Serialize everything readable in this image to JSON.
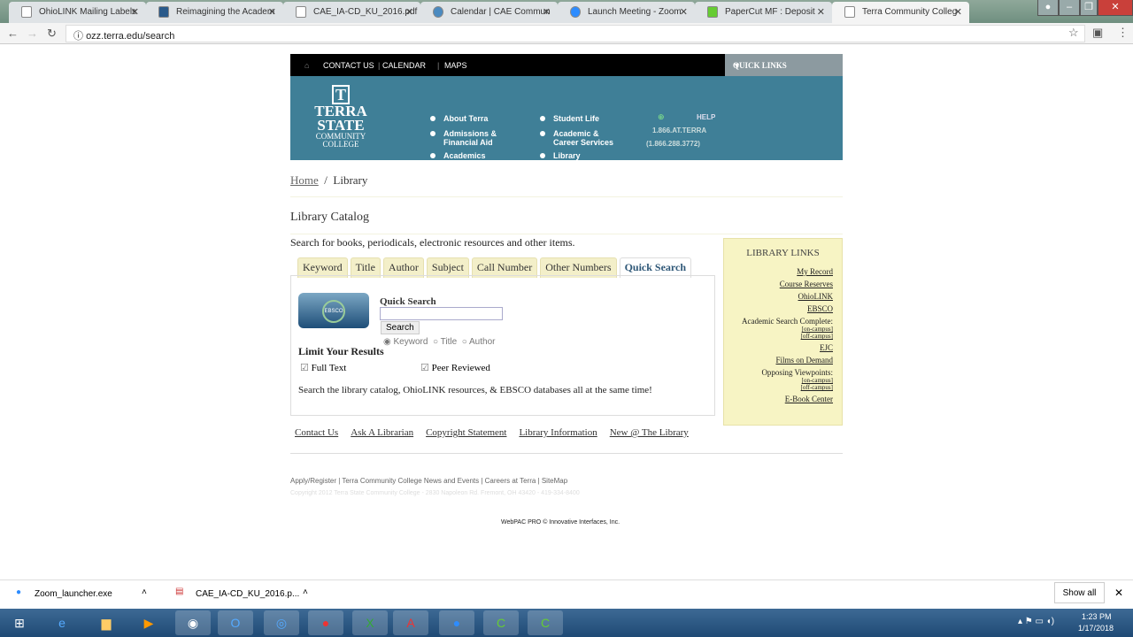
{
  "browser": {
    "tabs": [
      {
        "title": "OhioLINK Mailing Labels"
      },
      {
        "title": "Reimagining the Academ"
      },
      {
        "title": "CAE_IA-CD_KU_2016.pdf"
      },
      {
        "title": "Calendar | CAE Commun"
      },
      {
        "title": "Launch Meeting - Zoom"
      },
      {
        "title": "PaperCut MF : Deposit"
      },
      {
        "title": "Terra Community Colleg",
        "active": true
      }
    ],
    "url": "ozz.terra.edu/search"
  },
  "site": {
    "topnav": [
      "CONTACT US",
      "CALENDAR",
      "MAPS"
    ],
    "quick_links": "QUICK LINKS",
    "logo": {
      "l1": "TERRA",
      "l2": "STATE",
      "l3": "COMMUNITY",
      "l4": "COLLEGE",
      "mark": "T"
    },
    "nav": [
      "About Terra",
      "Admissions & Financial Aid",
      "Academics",
      "Student Life",
      "Academic & Career Services",
      "Library"
    ],
    "help": "HELP",
    "phone1": "1.866.AT.TERRA",
    "phone2": "(1.866.288.3772)",
    "colors": {
      "banner": "#3f7f97",
      "topbar": "#000000"
    }
  },
  "breadcrumb": {
    "home": "Home",
    "current": "Library"
  },
  "title": "Library Catalog",
  "intro": "Search for books, periodicals, electronic resources and other items.",
  "search_tabs": [
    "Keyword",
    "Title",
    "Author",
    "Subject",
    "Call Number",
    "Other Numbers",
    "Quick Search"
  ],
  "quick": {
    "label": "Quick Search",
    "value": "",
    "button": "Search",
    "radios": [
      "Keyword",
      "Title",
      "Author"
    ],
    "selected": "Keyword",
    "limit": "Limit Your Results",
    "full_text": "Full Text",
    "peer": "Peer Reviewed",
    "note": "Search the library catalog, OhioLINK resources, & EBSCO databases all at the same time!",
    "logo": "EBSCO"
  },
  "library_links": {
    "title": "LIBRARY LINKS",
    "my_record": "My Record",
    "course": "Course Reserves",
    "ohiolink": "OhioLINK",
    "ebsco": "EBSCO",
    "asc": "Academic Search Complete:",
    "on": "[on-campus]",
    "off": "[off-campus]",
    "ejc": "EJC",
    "films": "Films on Demand",
    "ov": "Opposing Viewpoints:",
    "ebook": "E-Book Center"
  },
  "footer_links": [
    "Contact Us",
    "Ask A Librarian",
    "Copyright Statement",
    "Library Information",
    "New @ The Library"
  ],
  "footer": {
    "links": "Apply/Register | Terra Community College News and Events | Careers at Terra | SiteMap",
    "copyright": "Copyright 2012 Terra State Community College - 2830 Napoleon Rd. Fremont, OH 43420 - 419-334-8400",
    "webpac": "WebPAC PRO © Innovative Interfaces, Inc."
  },
  "downloads": {
    "items": [
      "Zoom_launcher.exe",
      "CAE_IA-CD_KU_2016.p..."
    ],
    "show_all": "Show all"
  },
  "taskbar": {
    "time": "1:23 PM",
    "date": "1/17/2018"
  }
}
